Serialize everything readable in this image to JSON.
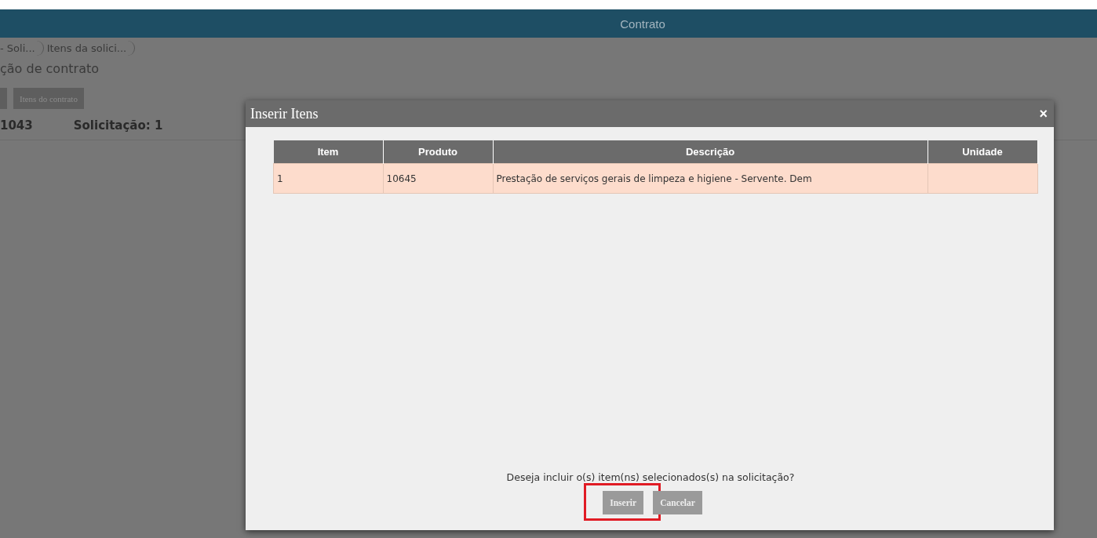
{
  "header": {
    "title": "Contrato"
  },
  "breadcrumbs": [
    {
      "label": "- Soli..."
    },
    {
      "label": "Itens da solici..."
    }
  ],
  "page_title": "ção de contrato",
  "toolbar": [
    {
      "kind": "partial"
    },
    {
      "kind": "labeled",
      "label": "Itens do contrato"
    }
  ],
  "info": [
    {
      "text": "1043"
    },
    {
      "text": "Solicitação: 1"
    }
  ],
  "dialog": {
    "title": "Inserir Itens",
    "close": "×",
    "table": {
      "columns": [
        "Item",
        "Produto",
        "Descrição",
        "Unidade"
      ],
      "rows": [
        {
          "cells": [
            "1",
            "10645",
            "Prestação de serviços gerais de limpeza e higiene - Servente. Dem",
            ""
          ],
          "selected": true
        }
      ]
    },
    "message": "Deseja incluir o(s) item(ns) selecionados(s) na solicitação?",
    "buttons": [
      {
        "label": "Inserir",
        "highlighted": true
      },
      {
        "label": "Cancelar",
        "highlighted": false
      }
    ]
  }
}
